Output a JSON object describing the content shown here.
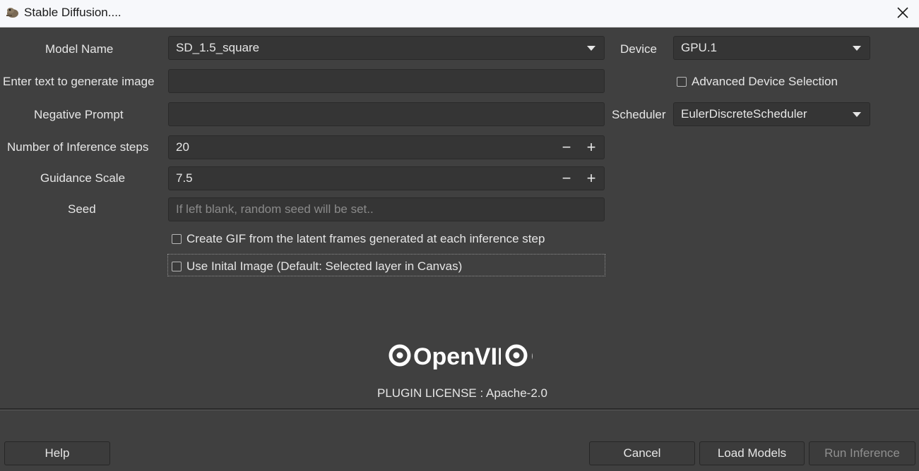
{
  "window": {
    "title": "Stable Diffusion....",
    "close_glyph": "✕"
  },
  "form": {
    "model_name": {
      "label": "Model Name",
      "value": "SD_1.5_square"
    },
    "prompt": {
      "label": "Enter text to generate image",
      "value": ""
    },
    "negative_prompt": {
      "label": "Negative Prompt",
      "value": ""
    },
    "inference_steps": {
      "label": "Number of Inference steps",
      "value": "20"
    },
    "guidance_scale": {
      "label": "Guidance Scale",
      "value": "7.5"
    },
    "seed": {
      "label": "Seed",
      "value": "",
      "placeholder": "If left blank, random seed will be set.."
    },
    "create_gif": {
      "label": "Create GIF from the latent frames generated at each inference step",
      "checked": false
    },
    "use_initial_image": {
      "label": "Use Inital Image (Default: Selected layer in Canvas)",
      "checked": false
    }
  },
  "device": {
    "label": "Device",
    "value": "GPU.1",
    "advanced_selection": {
      "label": "Advanced Device Selection",
      "checked": false
    }
  },
  "scheduler": {
    "label": "Scheduler",
    "value": "EulerDiscreteScheduler"
  },
  "spinner": {
    "minus": "−",
    "plus": "+"
  },
  "branding": {
    "logo_text": "OpenVINO",
    "license": "PLUGIN LICENSE : Apache-2.0"
  },
  "footer": {
    "help": "Help",
    "cancel": "Cancel",
    "load_models": "Load Models",
    "run_inference": "Run Inference"
  },
  "colors": {
    "background": "#404040",
    "field": "#353535",
    "text": "#e6e6e6",
    "disabled_text": "#8f8f8f"
  },
  "icons": {
    "app": "gimp-icon",
    "close": "close-icon",
    "dropdown": "chevron-down-icon",
    "decrement": "minus-icon",
    "increment": "plus-icon"
  }
}
